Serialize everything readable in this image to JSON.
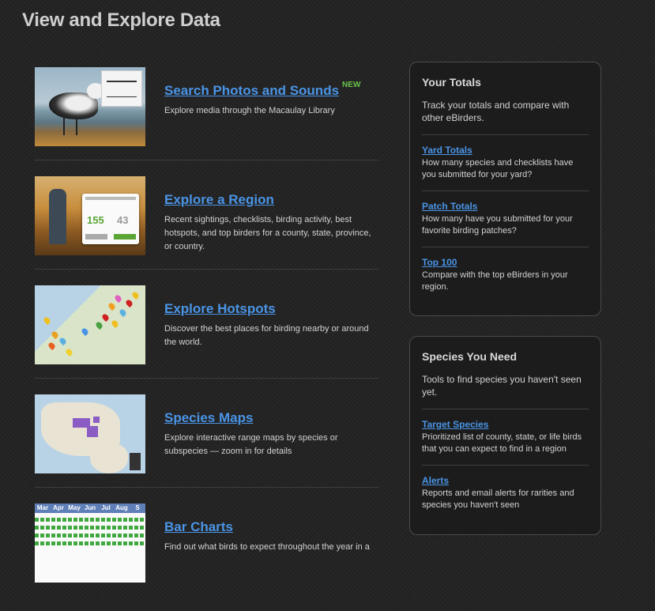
{
  "page": {
    "title": "View and Explore Data"
  },
  "features": [
    {
      "title": "Search Photos and Sounds",
      "badge": "NEW",
      "description": "Explore media through the Macaulay Library"
    },
    {
      "title": "Explore a Region",
      "badge": "",
      "description": "Recent sightings, checklists, birding activity, best hotspots, and top birders for a county, state, province, or country."
    },
    {
      "title": "Explore Hotspots",
      "badge": "",
      "description": "Discover the best places for birding nearby or around the world."
    },
    {
      "title": "Species Maps",
      "badge": "",
      "description": "Explore interactive range maps by species or subspecies — zoom in for details"
    },
    {
      "title": "Bar Charts",
      "badge": "",
      "description": "Find out what birds to expect throughout the year in a"
    }
  ],
  "region_card": {
    "species_count": "155",
    "checklists_count": "43"
  },
  "bar_chart_months": [
    "Mar",
    "Apr",
    "May",
    "Jun",
    "Jul",
    "Aug",
    "S"
  ],
  "your_totals": {
    "title": "Your Totals",
    "intro": "Track your totals and compare with other eBirders.",
    "items": [
      {
        "link": "Yard Totals",
        "description": "How many species and checklists have you submitted for your yard?"
      },
      {
        "link": "Patch Totals",
        "description": "How many have you submitted for your favorite birding patches?"
      },
      {
        "link": "Top 100",
        "description": "Compare with the top eBirders in your region."
      }
    ]
  },
  "species_you_need": {
    "title": "Species You Need",
    "intro": "Tools to find species you haven't seen yet.",
    "items": [
      {
        "link": "Target Species",
        "description": "Prioritized list of county, state, or life birds that you can expect to find in a region"
      },
      {
        "link": "Alerts",
        "description": "Reports and email alerts for rarities and species you haven't seen"
      }
    ]
  },
  "colors": {
    "link": "#4a94e6",
    "new_badge": "#69c24a",
    "background": "#242424"
  }
}
